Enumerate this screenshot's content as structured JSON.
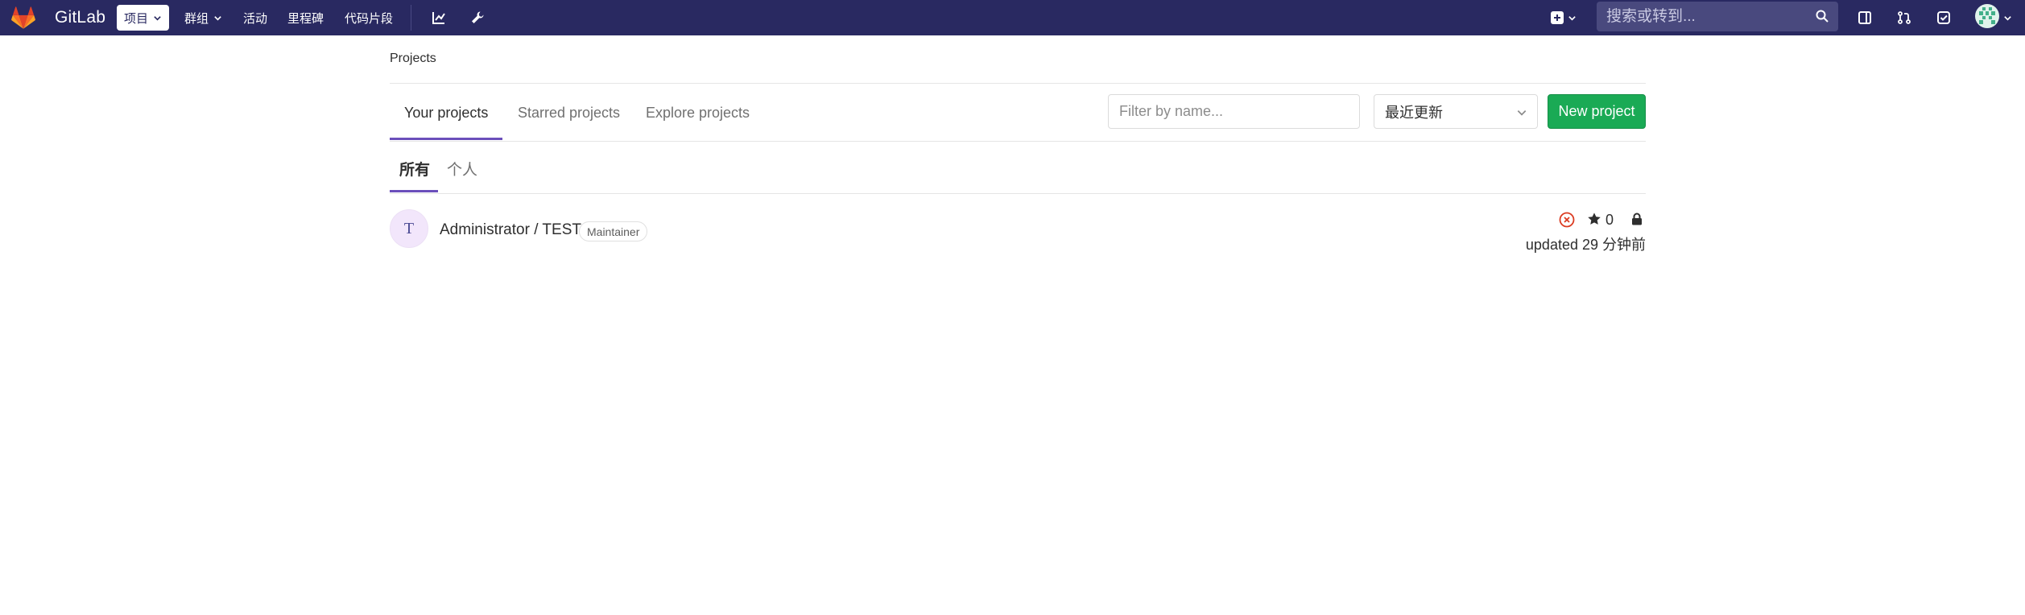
{
  "navbar": {
    "brand_name": "GitLab",
    "items": [
      {
        "label": "项目",
        "dropdown": true,
        "active": true
      },
      {
        "label": "群组",
        "dropdown": true,
        "active": false
      },
      {
        "label": "活动",
        "dropdown": false,
        "active": false
      },
      {
        "label": "里程碑",
        "dropdown": false,
        "active": false
      },
      {
        "label": "代码片段",
        "dropdown": false,
        "active": false
      }
    ],
    "icons": [
      "chart-icon",
      "wrench-icon",
      "plus-square-icon",
      "sidebar-panel-icon",
      "merge-request-icon",
      "todo-check-icon",
      "user-avatar"
    ],
    "search_placeholder": "搜索或转到...",
    "colors": {
      "navbar_bg": "#292961",
      "search_bg": "#49497e"
    }
  },
  "breadcrumb": "Projects",
  "tabs": [
    {
      "label": "Your projects",
      "active": true
    },
    {
      "label": "Starred projects",
      "active": false
    },
    {
      "label": "Explore projects",
      "active": false
    }
  ],
  "filter": {
    "placeholder": "Filter by name...",
    "value": ""
  },
  "sort": {
    "selected": "最近更新"
  },
  "new_project_label": "New project",
  "subtabs": [
    {
      "label": "所有",
      "active": true
    },
    {
      "label": "个人",
      "active": false
    }
  ],
  "projects": [
    {
      "avatar_letter": "T",
      "namespace": "Administrator / TEST",
      "role": "Maintainer",
      "pipeline_status": "failed",
      "stars": "0",
      "visibility": "private",
      "updated": "updated 29 分钟前"
    }
  ],
  "colors": {
    "accent": "#6b4fbb",
    "success": "#1aaa55",
    "danger": "#db3b21"
  }
}
